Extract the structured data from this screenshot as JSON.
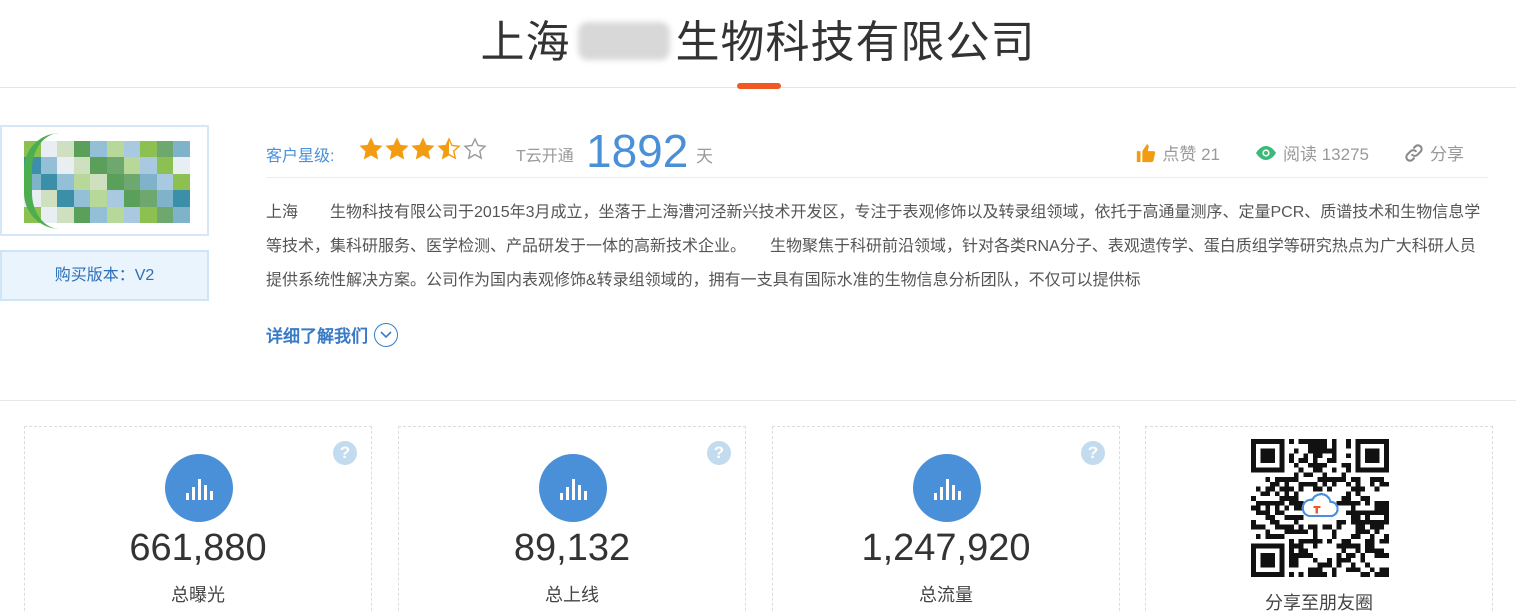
{
  "header": {
    "title": "上海　　 生物科技有限公司"
  },
  "profile": {
    "version_label": "购买版本：V2",
    "rating_label": "客户星级:",
    "rating_value": 3.5,
    "rating_max": 5,
    "tcloud_label": "T云开通",
    "tcloud_days": "1892",
    "tcloud_unit": "天",
    "likes_label": "点赞 21",
    "views_label": "阅读 13275",
    "share_label": "分享",
    "description": "上海　　生物科技有限公司于2015年3月成立，坐落于上海漕河泾新兴技术开发区，专注于表观修饰以及转录组领域，依托于高通量测序、定量PCR、质谱技术和生物信息学等技术，集科研服务、医学检测、产品研发于一体的高新技术企业。　　生物聚焦于科研前沿领域，针对各类RNA分子、表观遗传学、蛋白质组学等研究热点为广大科研人员提供系统性解决方案。公司作为国内表观修饰&转录组领域的，拥有一支具有国际水准的生物信息分析团队，不仅可以提供标",
    "more_label": "详细了解我们"
  },
  "stats": [
    {
      "value": "661,880",
      "label": "总曝光"
    },
    {
      "value": "89,132",
      "label": "总上线"
    },
    {
      "value": "1,247,920",
      "label": "总流量"
    }
  ],
  "qr": {
    "label": "分享至朋友圈"
  },
  "colors": {
    "accent_blue": "#4a90d9",
    "accent_orange": "#f05a22",
    "star": "#f39c12",
    "view_green": "#3cb878"
  }
}
